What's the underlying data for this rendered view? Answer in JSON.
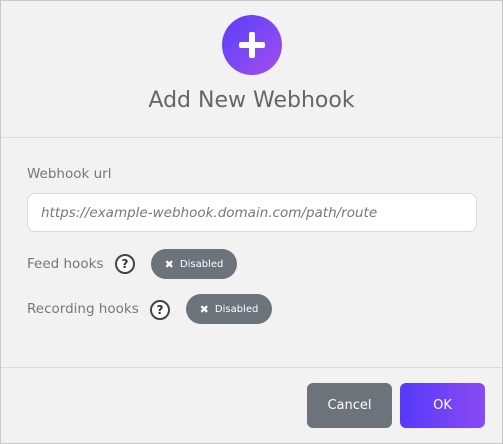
{
  "dialog": {
    "title": "Add New Webhook",
    "header_icon": "plus-icon"
  },
  "form": {
    "url_label": "Webhook url",
    "url_value": "",
    "url_placeholder": "https://example-webhook.domain.com/path/route",
    "feed_hooks": {
      "label": "Feed hooks",
      "help": "?",
      "toggle_label": "Disabled",
      "toggle_icon": "x-icon"
    },
    "recording_hooks": {
      "label": "Recording hooks",
      "help": "?",
      "toggle_label": "Disabled",
      "toggle_icon": "x-icon"
    }
  },
  "footer": {
    "cancel_label": "Cancel",
    "ok_label": "OK"
  },
  "colors": {
    "accent": "#5b3dfb",
    "accent_end": "#a94de8",
    "toggle_bg": "#6c737b",
    "cancel_bg": "#6c737b"
  }
}
